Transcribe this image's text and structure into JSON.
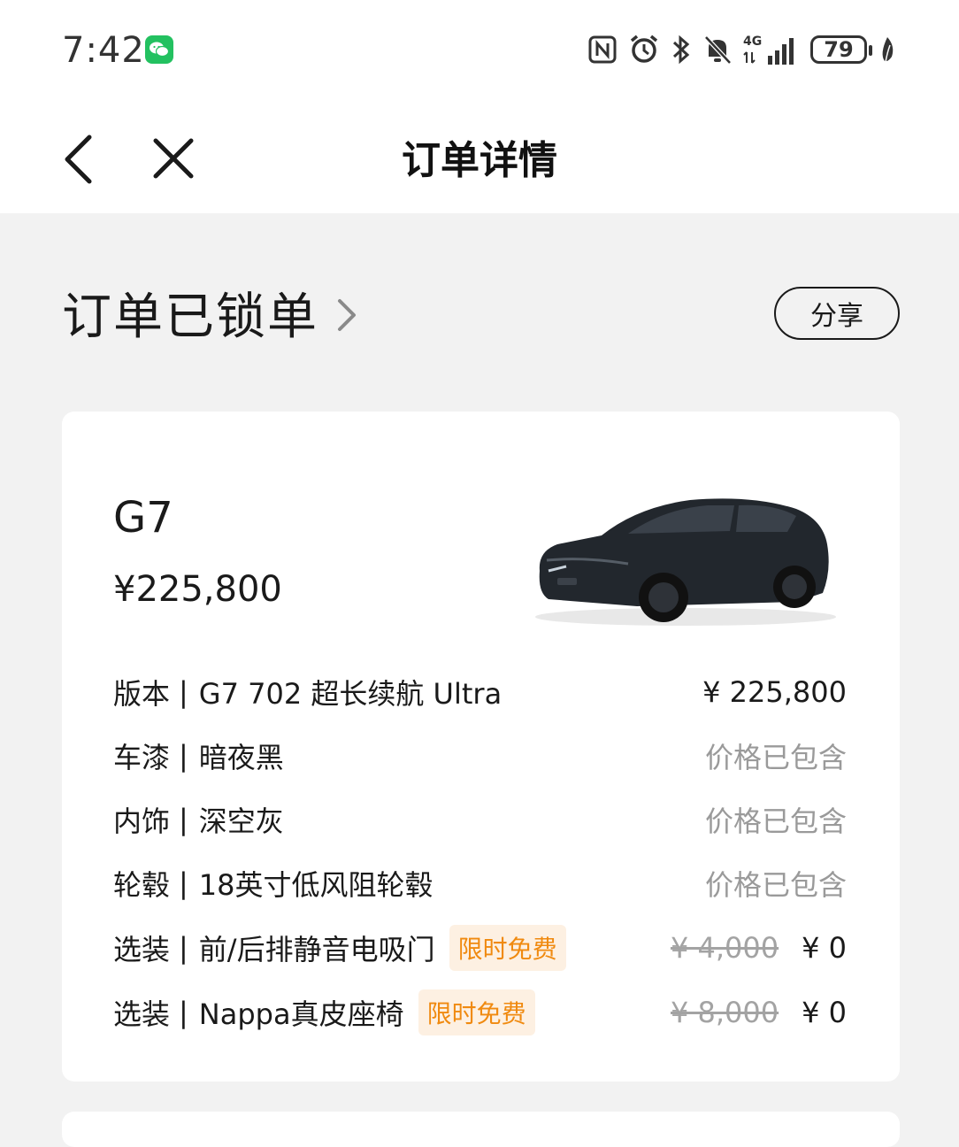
{
  "status_bar": {
    "time": "7:42",
    "battery": "79",
    "network": "4G",
    "icons": [
      "wechat-icon",
      "nfc-icon",
      "alarm-icon",
      "bluetooth-icon",
      "mute-icon",
      "signal-icon",
      "battery-icon",
      "leaf-icon"
    ]
  },
  "nav": {
    "title": "订单详情",
    "back_icon": "back-chevron-icon",
    "close_icon": "close-icon"
  },
  "order": {
    "status": "订单已锁单",
    "share_label": "分享"
  },
  "car": {
    "model": "G7",
    "price": "¥225,800",
    "image": "car-image"
  },
  "specs": [
    {
      "category": "版本",
      "sep": "|",
      "value": "G7 702 超长续航 Ultra",
      "price": "¥ 225,800"
    },
    {
      "category": "车漆",
      "sep": "|",
      "value": "暗夜黑",
      "price": "价格已包含"
    },
    {
      "category": "内饰",
      "sep": "|",
      "value": "深空灰",
      "price": "价格已包含"
    },
    {
      "category": "轮毂",
      "sep": "|",
      "value": "18英寸低风阻轮毂",
      "price": "价格已包含"
    },
    {
      "category": "选装",
      "sep": "|",
      "value": "前/后排静音电吸门",
      "tag": "限时免费",
      "original_price": "¥ 4,000",
      "price": "¥ 0"
    },
    {
      "category": "选装",
      "sep": "|",
      "value": "Nappa真皮座椅",
      "tag": "限时免费",
      "original_price": "¥ 8,000",
      "price": "¥ 0"
    }
  ],
  "colors": {
    "background": "#f2f2f2",
    "card": "#ffffff",
    "promo_bg": "#fdf0e2",
    "promo_text": "#f08a10",
    "muted_text": "#9a9a9a",
    "wechat_green": "#23c160"
  }
}
